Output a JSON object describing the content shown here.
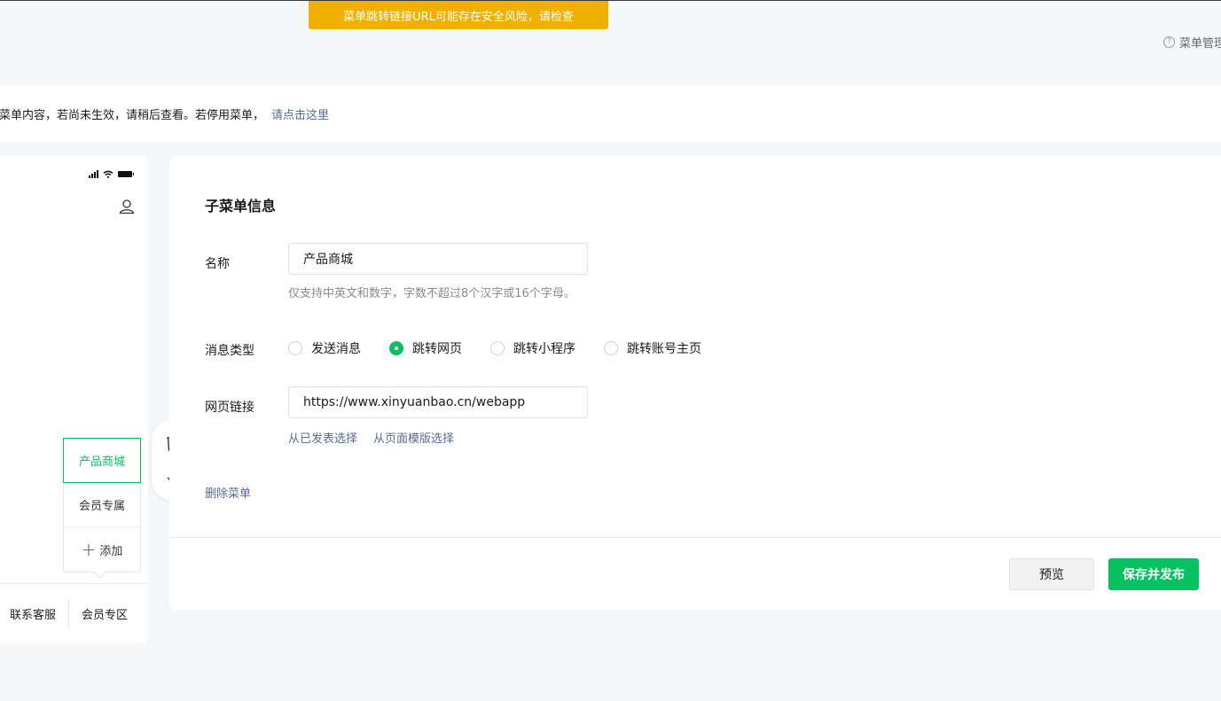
{
  "banner": {
    "warning": "菜单跳转链接URL可能存在安全风险，请检查"
  },
  "help": {
    "icon": "question-circle-icon",
    "text": "菜单管理"
  },
  "notice": {
    "text": "请菜单内容，若尚未生效，请稍后查看。若停用菜单，",
    "link": "请点击这里"
  },
  "phone": {
    "submenu": [
      {
        "label": "产品商城",
        "active": true
      },
      {
        "label": "会员专属",
        "active": false
      }
    ],
    "add_label": "添加",
    "bottom_menu": [
      "联系客服",
      "会员专区"
    ]
  },
  "form": {
    "title": "子菜单信息",
    "name_label": "名称",
    "name_value": "产品商城",
    "name_hint": "仅支持中英文和数字，字数不超过8个汉字或16个字母。",
    "type_label": "消息类型",
    "types": [
      {
        "label": "发送消息",
        "checked": false
      },
      {
        "label": "跳转网页",
        "checked": true
      },
      {
        "label": "跳转小程序",
        "checked": false
      },
      {
        "label": "跳转账号主页",
        "checked": false
      }
    ],
    "url_label": "网页链接",
    "url_value": "https://www.xinyuanbao.cn/webapp",
    "link_from_published": "从已发表选择",
    "link_from_template": "从页面模版选择",
    "delete_label": "删除菜单"
  },
  "actions": {
    "preview": "预览",
    "publish": "保存并发布"
  },
  "colors": {
    "accent": "#07c160",
    "warning": "#efb000",
    "link": "#576b95"
  }
}
